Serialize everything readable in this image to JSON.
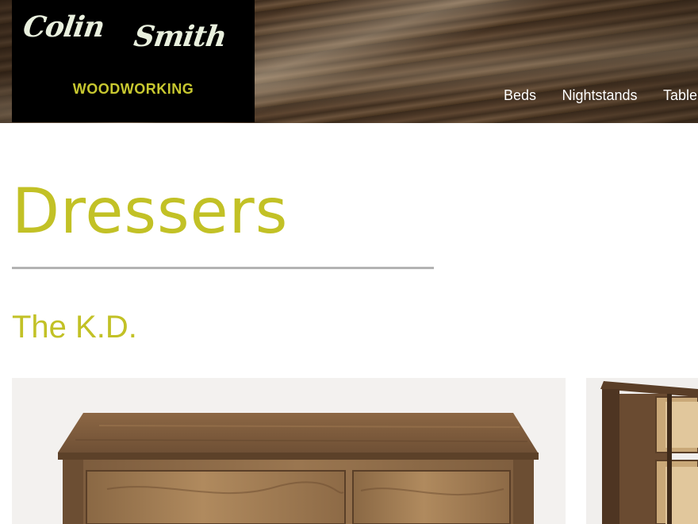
{
  "brand": {
    "script_line1": "Colin",
    "script_line2": "Smith",
    "sub": "WOODWORKING",
    "accent_color": "#c2c126"
  },
  "nav": {
    "items": [
      {
        "label": "Beds"
      },
      {
        "label": "Nightstands"
      },
      {
        "label": "Table"
      }
    ]
  },
  "page": {
    "title": "Dressers",
    "product_title": "The K.D."
  },
  "images": {
    "main": "walnut-dresser-front-photo",
    "side": "walnut-dresser-side-photo"
  }
}
